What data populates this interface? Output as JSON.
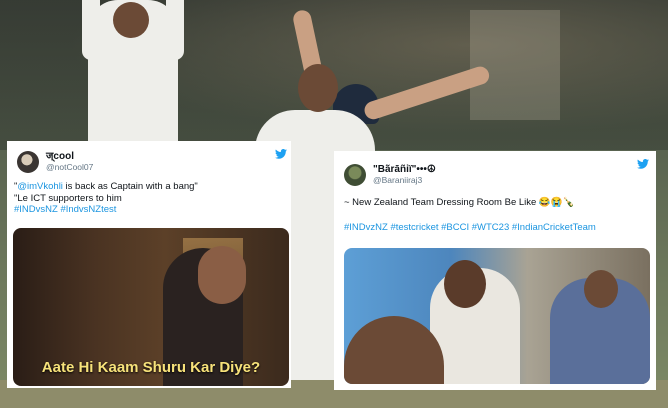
{
  "tweet1": {
    "display_name": "ज्cool",
    "handle": "@notCool07",
    "text_prefix": "\"",
    "mention": "@imVkohli",
    "text_suffix": " is back as Captain with a bang\"",
    "line2": "\"Le ICT supporters to him",
    "hashtags": "#INDvsNZ #IndvsNZtest",
    "media_caption": "Aate Hi Kaam Shuru Kar Diye?"
  },
  "tweet2": {
    "display_name": "\"Bãrāñiï\"•••☮",
    "handle": "@Baraniiraj3",
    "text": "~ New Zealand Team Dressing Room Be Like 😂😭🍾",
    "hashtags": "#INDvzNZ #testcricket #BCCI #WTC23 #IndianCricketTeam"
  },
  "colors": {
    "link": "#1b95e0",
    "twitter_blue": "#1da1f2",
    "caption_yellow": "#f7e27a"
  },
  "icons": [
    "twitter-bird-icon",
    "avatar"
  ]
}
